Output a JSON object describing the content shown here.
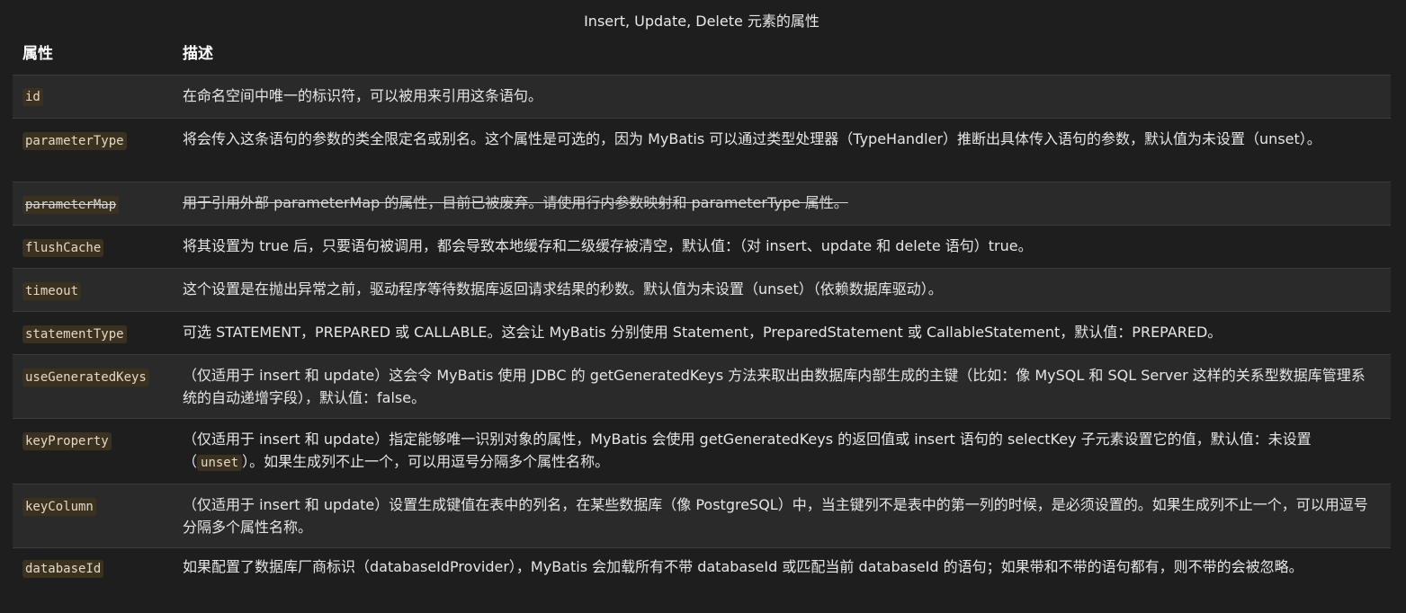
{
  "caption": "Insert, Update, Delete 元素的属性",
  "headers": {
    "attr": "属性",
    "desc": "描述"
  },
  "rows": [
    {
      "attr": "id",
      "desc": "在命名空间中唯一的标识符，可以被用来引用这条语句。"
    },
    {
      "attr": "parameterType",
      "desc": "将会传入这条语句的参数的类全限定名或别名。这个属性是可选的，因为 MyBatis 可以通过类型处理器（TypeHandler）推断出具体传入语句的参数，默认值为未设置（unset）。"
    },
    {
      "attr": "parameterMap",
      "desc": "用于引用外部 parameterMap 的属性，目前已被废弃。请使用行内参数映射和 parameterType 属性。"
    },
    {
      "attr": "flushCache",
      "desc": "将其设置为 true 后，只要语句被调用，都会导致本地缓存和二级缓存被清空，默认值：（对 insert、update 和 delete 语句）true。"
    },
    {
      "attr": "timeout",
      "desc": "这个设置是在抛出异常之前，驱动程序等待数据库返回请求结果的秒数。默认值为未设置（unset）（依赖数据库驱动）。"
    },
    {
      "attr": "statementType",
      "desc": "可选 STATEMENT，PREPARED 或 CALLABLE。这会让 MyBatis 分别使用 Statement，PreparedStatement 或 CallableStatement，默认值：PREPARED。"
    },
    {
      "attr": "useGeneratedKeys",
      "desc": "（仅适用于 insert 和 update）这会令 MyBatis 使用 JDBC 的 getGeneratedKeys 方法来取出由数据库内部生成的主键（比如：像 MySQL 和 SQL Server 这样的关系型数据库管理系统的自动递增字段），默认值：false。"
    },
    {
      "attr": "keyProperty",
      "desc_before": "（仅适用于 insert 和 update）指定能够唯一识别对象的属性，MyBatis 会使用 getGeneratedKeys 的返回值或 insert 语句的 selectKey 子元素设置它的值，默认值：未设置（",
      "desc_code": "unset",
      "desc_after": "）。如果生成列不止一个，可以用逗号分隔多个属性名称。"
    },
    {
      "attr": "keyColumn",
      "desc": "（仅适用于 insert 和 update）设置生成键值在表中的列名，在某些数据库（像 PostgreSQL）中，当主键列不是表中的第一列的时候，是必须设置的。如果生成列不止一个，可以用逗号分隔多个属性名称。"
    },
    {
      "attr": "databaseId",
      "desc": "如果配置了数据库厂商标识（databaseIdProvider），MyBatis 会加载所有不带 databaseId 或匹配当前 databaseId 的语句；如果带和不带的语句都有，则不带的会被忽略。"
    }
  ]
}
